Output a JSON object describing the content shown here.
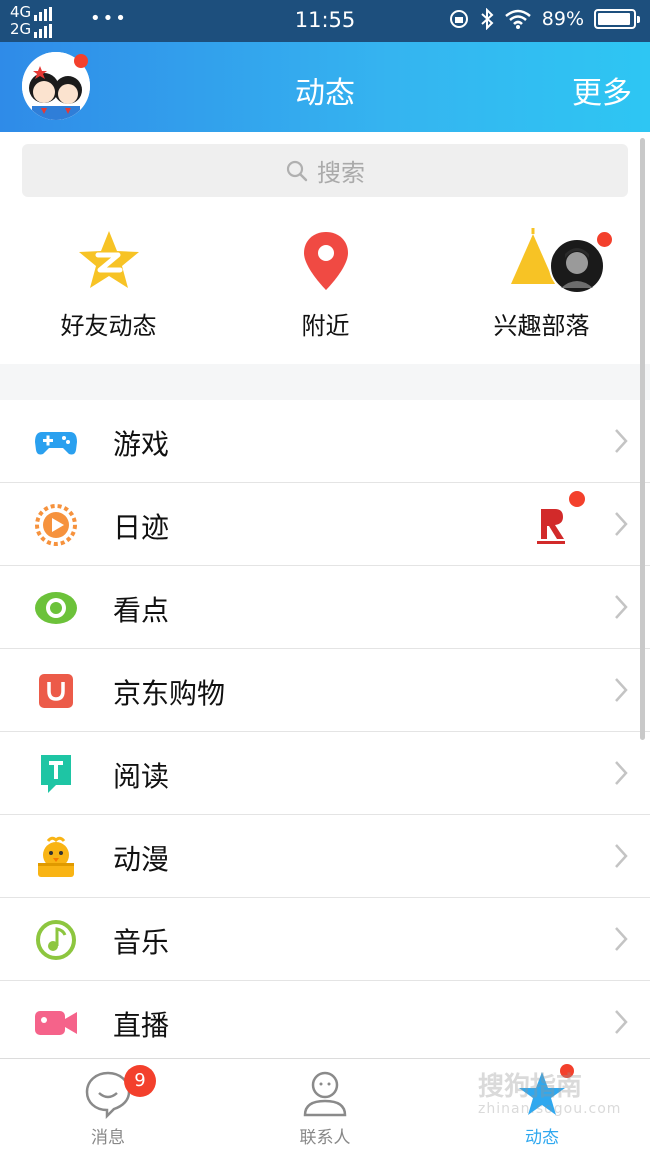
{
  "status_bar": {
    "network_top": "4G",
    "network_bottom": "2G",
    "more_dots": "•••",
    "time": "11:55",
    "battery": "89%"
  },
  "header": {
    "title": "动态",
    "more": "更多"
  },
  "search": {
    "placeholder": "搜索"
  },
  "quick_links": [
    {
      "label": "好友动态",
      "icon": "star-z-icon"
    },
    {
      "label": "附近",
      "icon": "location-pin-icon"
    },
    {
      "label": "兴趣部落",
      "icon": "tent-icon"
    }
  ],
  "menu": [
    {
      "label": "游戏",
      "icon": "gamepad-icon",
      "color": "#2aa0ef"
    },
    {
      "label": "日迹",
      "icon": "play-circle-icon",
      "color": "#f6923d"
    },
    {
      "label": "看点",
      "icon": "eye-icon",
      "color": "#6cc23a"
    },
    {
      "label": "京东购物",
      "icon": "shopping-bag-icon",
      "color": "#ec5b49"
    },
    {
      "label": "阅读",
      "icon": "book-icon",
      "color": "#1ec5a4"
    },
    {
      "label": "动漫",
      "icon": "anime-chick-icon",
      "color": "#f9b414"
    },
    {
      "label": "音乐",
      "icon": "music-note-icon",
      "color": "#8dc63f"
    },
    {
      "label": "直播",
      "icon": "video-camera-icon",
      "color": "#f5638a"
    }
  ],
  "tabs": [
    {
      "label": "消息",
      "badge": "9"
    },
    {
      "label": "联系人"
    },
    {
      "label": "动态",
      "active": true
    }
  ],
  "watermark": {
    "text": "搜狗指南",
    "sub": "zhinan.sogou.com"
  },
  "colors": {
    "accent": "#2fa8ef",
    "badge": "#f3402c",
    "statusbar": "#1d4f7d"
  }
}
